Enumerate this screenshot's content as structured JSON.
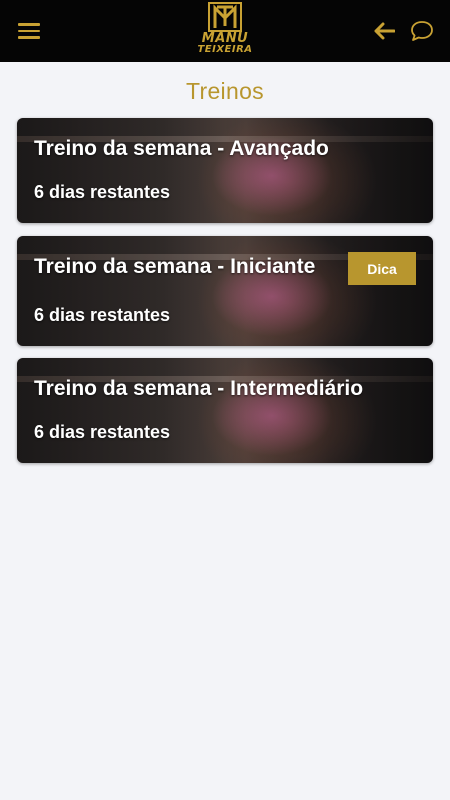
{
  "header": {
    "menu_icon": "hamburger-icon",
    "logo_text_line1": "MANU",
    "logo_text_line2": "TEIXEIRA",
    "logo_monogram": "MT",
    "back_icon": "arrow-left-icon",
    "chat_icon": "chat-bubble-icon",
    "accent_color": "#c9a233",
    "background_color": "#050505"
  },
  "page": {
    "title": "Treinos",
    "title_color": "#b8962e",
    "background": "#f3f4f8"
  },
  "cards": [
    {
      "title": "Treino da semana - Avançado",
      "subtitle": "6 dias restantes"
    },
    {
      "title": "Treino da semana - Iniciante",
      "subtitle": "6 dias restantes",
      "badge": "Dica"
    },
    {
      "title": "Treino da semana - Intermediário",
      "subtitle": "6 dias restantes"
    }
  ]
}
